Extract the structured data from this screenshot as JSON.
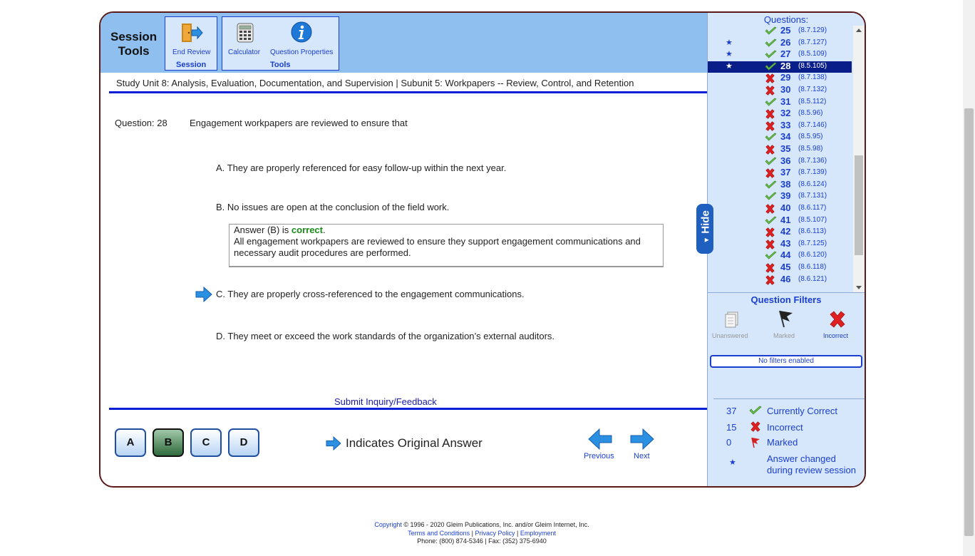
{
  "toolbar": {
    "session_title_1": "Session",
    "session_title_2": "Tools",
    "end_review_label": "End Review",
    "session_group_label": "Session",
    "calculator_label": "Calculator",
    "question_properties_label": "Question Properties",
    "tools_group_label": "Tools"
  },
  "study_unit": "Study Unit 8: Analysis, Evaluation, Documentation, and Supervision | Subunit 5: Workpapers -- Review, Control, and Retention",
  "question": {
    "label": "Question: 28",
    "text": "Engagement workpapers are reviewed to ensure that",
    "choices": [
      {
        "letter": "A.",
        "text": "They are properly referenced for easy follow-up within the next year."
      },
      {
        "letter": "B.",
        "text": "No issues are open at the conclusion of the field work."
      },
      {
        "letter": "C.",
        "text": "They are properly cross-referenced to the engagement communications."
      },
      {
        "letter": "D.",
        "text": "They meet or exceed the work standards of the organization’s external auditors."
      }
    ],
    "answer_prefix": "Answer (B) is ",
    "answer_status": "correct",
    "answer_suffix": ".",
    "explanation": "All engagement workpapers are reviewed to ensure they support engagement communications and necessary audit procedures are performed."
  },
  "submit_inquiry": "Submit Inquiry/Feedback",
  "answer_buttons": [
    "A",
    "B",
    "C",
    "D"
  ],
  "selected_answer": "B",
  "original_answer_legend": "Indicates Original Answer",
  "nav": {
    "previous": "Previous",
    "next": "Next"
  },
  "side": {
    "header": "Questions:",
    "questions": [
      {
        "num": "25",
        "ref": "(8.7.129)",
        "status": "correct",
        "star": ""
      },
      {
        "num": "26",
        "ref": "(8.7.127)",
        "status": "correct",
        "star": "★"
      },
      {
        "num": "27",
        "ref": "(8.5.109)",
        "status": "correct",
        "star": "★"
      },
      {
        "num": "28",
        "ref": "(8.5.105)",
        "status": "correct",
        "star": "★",
        "current": true
      },
      {
        "num": "29",
        "ref": "(8.7.138)",
        "status": "incorrect",
        "star": ""
      },
      {
        "num": "30",
        "ref": "(8.7.132)",
        "status": "incorrect",
        "star": ""
      },
      {
        "num": "31",
        "ref": "(8.5.112)",
        "status": "correct",
        "star": ""
      },
      {
        "num": "32",
        "ref": "(8.5.96)",
        "status": "incorrect",
        "star": ""
      },
      {
        "num": "33",
        "ref": "(8.7.146)",
        "status": "incorrect",
        "star": ""
      },
      {
        "num": "34",
        "ref": "(8.5.95)",
        "status": "correct",
        "star": ""
      },
      {
        "num": "35",
        "ref": "(8.5.98)",
        "status": "incorrect",
        "star": ""
      },
      {
        "num": "36",
        "ref": "(8.7.136)",
        "status": "correct",
        "star": ""
      },
      {
        "num": "37",
        "ref": "(8.7.139)",
        "status": "incorrect",
        "star": ""
      },
      {
        "num": "38",
        "ref": "(8.6.124)",
        "status": "correct",
        "star": ""
      },
      {
        "num": "39",
        "ref": "(8.7.131)",
        "status": "correct",
        "star": ""
      },
      {
        "num": "40",
        "ref": "(8.6.117)",
        "status": "incorrect",
        "star": ""
      },
      {
        "num": "41",
        "ref": "(8.5.107)",
        "status": "correct",
        "star": ""
      },
      {
        "num": "42",
        "ref": "(8.6.113)",
        "status": "incorrect",
        "star": ""
      },
      {
        "num": "43",
        "ref": "(8.7.125)",
        "status": "incorrect",
        "star": ""
      },
      {
        "num": "44",
        "ref": "(8.6.120)",
        "status": "correct",
        "star": ""
      },
      {
        "num": "45",
        "ref": "(8.6.118)",
        "status": "incorrect",
        "star": ""
      },
      {
        "num": "46",
        "ref": "(8.6.121)",
        "status": "incorrect",
        "star": ""
      }
    ],
    "filters_title": "Question Filters",
    "filter_unanswered": "Unanswered",
    "filter_marked": "Marked",
    "filter_incorrect": "Incorrect",
    "no_filters": "No filters enabled",
    "stats": {
      "correct_count": "37",
      "correct_label": "Currently Correct",
      "incorrect_count": "15",
      "incorrect_label": "Incorrect",
      "marked_count": "0",
      "marked_label": "Marked",
      "changed_label_1": "Answer changed",
      "changed_label_2": "during review session",
      "star": "★"
    },
    "hide_tab": "Hide"
  },
  "footer": {
    "copyright_link": "Copyright",
    "copyright_text": " © 1996 - 2020 Gleim Publications, Inc. and/or Gleim Internet, Inc.",
    "terms": "Terms and Conditions",
    "privacy": "Privacy Policy",
    "employment": "Employment",
    "sep": " | ",
    "phone": "Phone: (800) 874-5346 | Fax: (352) 375-6940"
  },
  "colors": {
    "accent": "#1a3fd0",
    "correct": "#1a8a1a",
    "incorrect": "#d42020",
    "current_row": "#0a1e8a"
  },
  "icons": [
    "end-review-door-icon",
    "calculator-icon",
    "info-icon",
    "original-answer-arrow-icon",
    "previous-arrow-icon",
    "next-arrow-icon",
    "check-icon",
    "x-icon",
    "flag-icon",
    "unanswered-icon"
  ]
}
